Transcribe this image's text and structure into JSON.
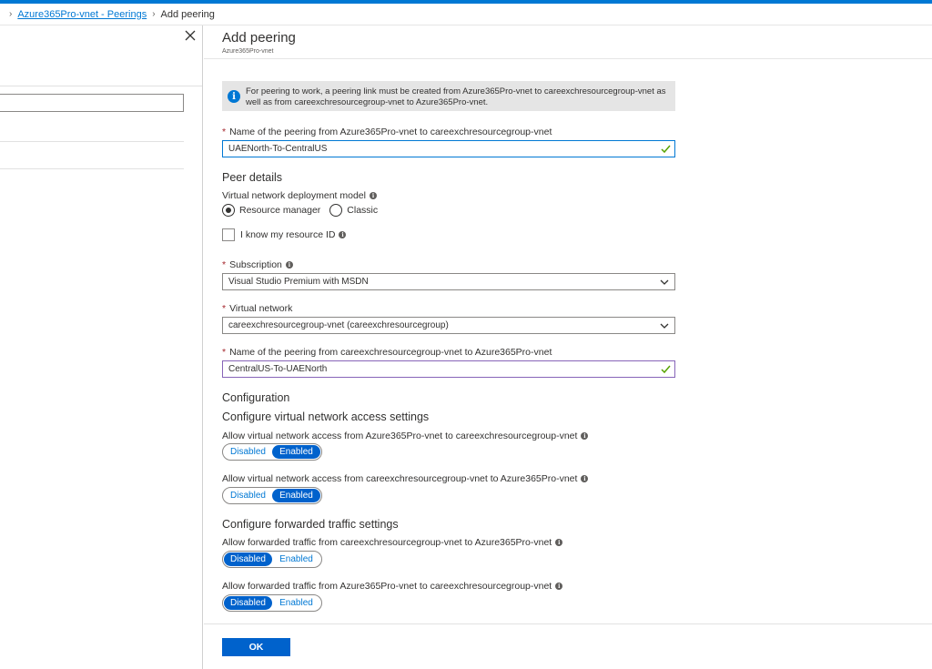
{
  "breadcrumb": {
    "items": [
      "Azure365Pro-vnet - Peerings",
      "Add peering"
    ]
  },
  "blade": {
    "title": "Add peering",
    "subtitle": "Azure365Pro-vnet"
  },
  "info": {
    "icon": "info-icon",
    "text": "For peering to work, a peering link must be created from Azure365Pro-vnet to careexchresourcegroup-vnet as well as from careexchresourcegroup-vnet to Azure365Pro-vnet."
  },
  "peering_name": {
    "label": "Name of the peering from Azure365Pro-vnet to careexchresourcegroup-vnet",
    "value": "UAENorth-To-CentralUS"
  },
  "peer_details": {
    "title": "Peer details",
    "deployment_model_label": "Virtual network deployment model",
    "options": [
      "Resource manager",
      "Classic"
    ],
    "selected": "Resource manager",
    "resource_id_label": "I know my resource ID"
  },
  "subscription": {
    "label": "Subscription",
    "value": "Visual Studio Premium with MSDN"
  },
  "virtual_network": {
    "label": "Virtual network",
    "value": "careexchresourcegroup-vnet (careexchresourcegroup)"
  },
  "remote_peering_name": {
    "label": "Name of the peering from careexchresourcegroup-vnet to Azure365Pro-vnet",
    "value": "CentralUS-To-UAENorth"
  },
  "configuration": {
    "title": "Configuration",
    "access_title": "Configure virtual network access settings",
    "access1_label": "Allow virtual network access from Azure365Pro-vnet to careexchresourcegroup-vnet",
    "access2_label": "Allow virtual network access from careexchresourcegroup-vnet to Azure365Pro-vnet",
    "forwarded_title": "Configure forwarded traffic settings",
    "forward1_label": "Allow forwarded traffic from careexchresourcegroup-vnet to Azure365Pro-vnet",
    "forward2_label": "Allow forwarded traffic from Azure365Pro-vnet to careexchresourcegroup-vnet",
    "toggle_disabled": "Disabled",
    "toggle_enabled": "Enabled",
    "access1_state": "Enabled",
    "access2_state": "Enabled",
    "forward1_state": "Disabled",
    "forward2_state": "Disabled"
  },
  "footer": {
    "ok_label": "OK"
  },
  "colors": {
    "accent": "#0078d4",
    "button": "#0062cc",
    "required": "#a4262c",
    "valid": "#57a300",
    "focus_border": "#8764b8"
  }
}
